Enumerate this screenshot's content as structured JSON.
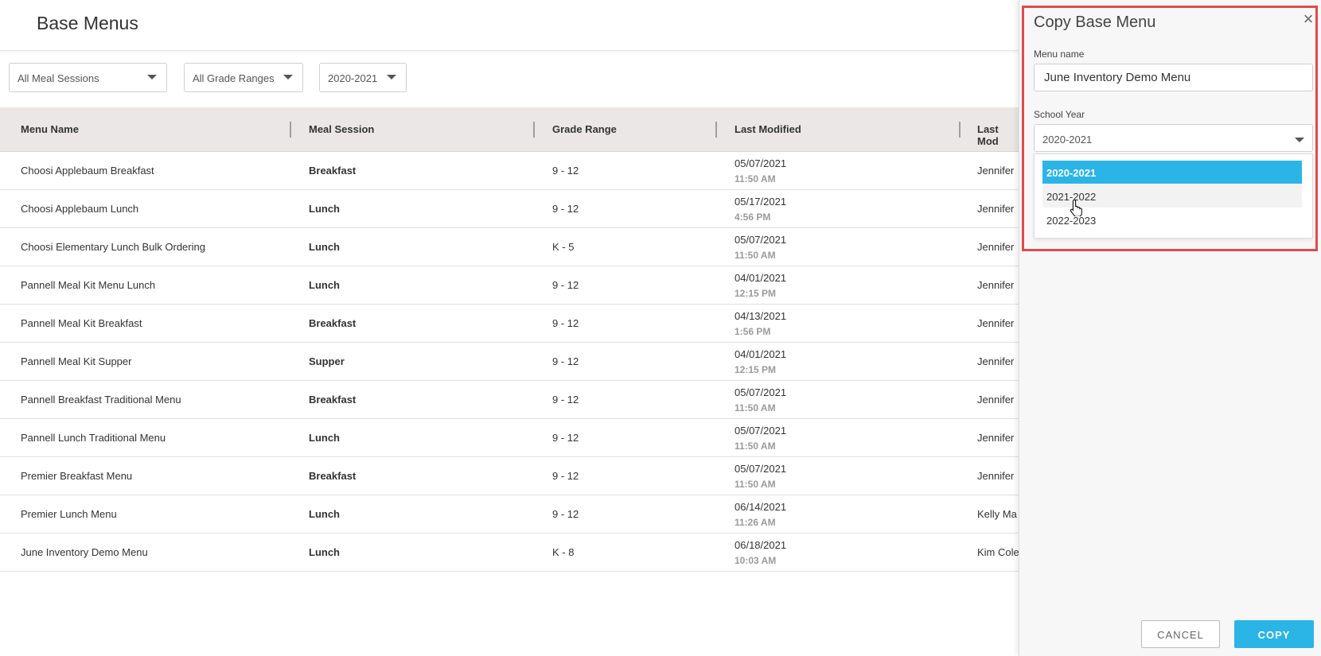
{
  "header": {
    "title": "Base Menus"
  },
  "filters": {
    "meal_session": "All Meal Sessions",
    "grade_range": "All Grade Ranges",
    "school_year": "2020-2021"
  },
  "table": {
    "columns": [
      "Menu Name",
      "Meal Session",
      "Grade Range",
      "Last Modified",
      "Last Mod"
    ],
    "rows": [
      {
        "name": "Choosi Applebaum Breakfast",
        "session": "Breakfast",
        "grade": "9 - 12",
        "date": "05/07/2021",
        "time": "11:50 AM",
        "user": "Jennifer"
      },
      {
        "name": "Choosi Applebaum Lunch",
        "session": "Lunch",
        "grade": "9 - 12",
        "date": "05/17/2021",
        "time": "4:56 PM",
        "user": "Jennifer"
      },
      {
        "name": "Choosi Elementary Lunch Bulk Ordering",
        "session": "Lunch",
        "grade": "K - 5",
        "date": "05/07/2021",
        "time": "11:50 AM",
        "user": "Jennifer"
      },
      {
        "name": "Pannell Meal Kit Menu Lunch",
        "session": "Lunch",
        "grade": "9 - 12",
        "date": "04/01/2021",
        "time": "12:15 PM",
        "user": "Jennifer"
      },
      {
        "name": "Pannell Meal Kit Breakfast",
        "session": "Breakfast",
        "grade": "9 - 12",
        "date": "04/13/2021",
        "time": "1:56 PM",
        "user": "Jennifer"
      },
      {
        "name": "Pannell Meal Kit Supper",
        "session": "Supper",
        "grade": "9 - 12",
        "date": "04/01/2021",
        "time": "12:15 PM",
        "user": "Jennifer"
      },
      {
        "name": "Pannell Breakfast Traditional Menu",
        "session": "Breakfast",
        "grade": "9 - 12",
        "date": "05/07/2021",
        "time": "11:50 AM",
        "user": "Jennifer"
      },
      {
        "name": "Pannell Lunch Traditional Menu",
        "session": "Lunch",
        "grade": "9 - 12",
        "date": "05/07/2021",
        "time": "11:50 AM",
        "user": "Jennifer"
      },
      {
        "name": "Premier Breakfast Menu",
        "session": "Breakfast",
        "grade": "9 - 12",
        "date": "05/07/2021",
        "time": "11:50 AM",
        "user": "Jennifer"
      },
      {
        "name": "Premier Lunch Menu",
        "session": "Lunch",
        "grade": "9 - 12",
        "date": "06/14/2021",
        "time": "11:26 AM",
        "user": "Kelly Ma"
      },
      {
        "name": "June Inventory Demo Menu",
        "session": "Lunch",
        "grade": "K - 8",
        "date": "06/18/2021",
        "time": "10:03 AM",
        "user": "Kim Cole"
      }
    ]
  },
  "panel": {
    "title": "Copy Base Menu",
    "close_icon": "close-icon",
    "menu_name_label": "Menu name",
    "menu_name_value": "June Inventory Demo Menu",
    "school_year_label": "School Year",
    "school_year_value": "2020-2021",
    "options": [
      "2020-2021",
      "2021-2022",
      "2022-2023"
    ],
    "cancel_label": "CANCEL",
    "copy_label": "COPY"
  },
  "colors": {
    "accent": "#2bb4e6",
    "highlight": "#e04b4b",
    "header_bg": "#ebe7e7"
  }
}
